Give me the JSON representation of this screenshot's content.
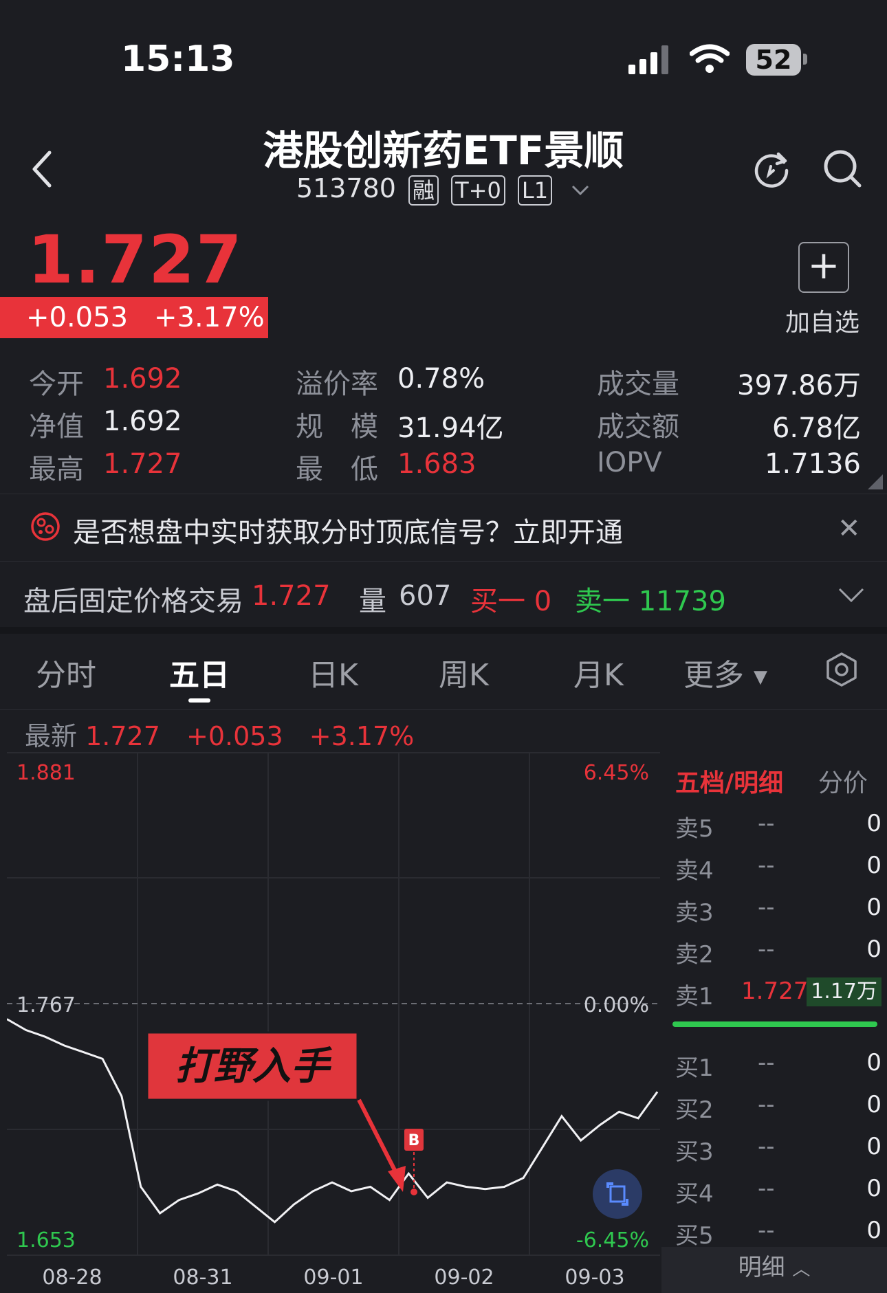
{
  "status": {
    "time": "15:13",
    "battery": "52"
  },
  "header": {
    "title": "港股创新药ETF景顺",
    "code": "513780",
    "tags": [
      "融",
      "T+0",
      "L1"
    ]
  },
  "quote": {
    "price": "1.727",
    "change": "+0.053",
    "change_pct": "+3.17%",
    "add_watchlist": "加自选"
  },
  "stats": {
    "open_label": "今开",
    "open": "1.692",
    "nav_label": "净值",
    "nav": "1.692",
    "high_label": "最高",
    "high": "1.727",
    "premium_label": "溢价率",
    "premium": "0.78%",
    "scale_label": "规　模",
    "scale": "31.94亿",
    "low_label": "最　低",
    "low": "1.683",
    "volume_label": "成交量",
    "volume": "397.86万",
    "amount_label": "成交额",
    "amount": "6.78亿",
    "iopv_label": "IOPV",
    "iopv": "1.7136"
  },
  "banner": {
    "text": "是否想盘中实时获取分时顶底信号？立即开通"
  },
  "after_hours": {
    "label": "盘后固定价格交易",
    "price": "1.727",
    "vol_label": "量",
    "vol": "607",
    "buy1": "买一 0",
    "sell1": "卖一 11739"
  },
  "tabs": [
    "分时",
    "五日",
    "日K",
    "周K",
    "月K",
    "更多"
  ],
  "latest": {
    "label": "最新",
    "price": "1.727",
    "change": "+0.053",
    "pct": "+3.17%"
  },
  "chart_data": {
    "type": "line",
    "x": [
      "08-28",
      "08-31",
      "09-01",
      "09-02",
      "09-03"
    ],
    "y_axis_left": [
      "1.881",
      "1.767",
      "1.653"
    ],
    "y_axis_right": [
      "6.45%",
      "0.00%",
      "-6.45%"
    ],
    "ylim": [
      1.653,
      1.881
    ],
    "prev_close": 1.767,
    "series": [
      {
        "values": [
          1.76,
          1.755,
          1.752,
          1.748,
          1.745,
          1.742,
          1.725,
          1.684,
          1.672,
          1.678,
          1.681,
          1.685,
          1.682,
          1.675,
          1.668,
          1.676,
          1.682,
          1.686,
          1.682,
          1.684,
          1.678,
          1.69,
          1.679,
          1.686,
          1.684,
          1.683,
          1.684,
          1.688,
          1.702,
          1.716,
          1.705,
          1.712,
          1.718,
          1.715,
          1.727
        ]
      }
    ],
    "annotation": "打野入手",
    "marker": "B"
  },
  "orderbook": {
    "title": "五档/明细",
    "tab2": "分价",
    "asks": [
      {
        "label": "卖5",
        "price": "--",
        "vol": "0"
      },
      {
        "label": "卖4",
        "price": "--",
        "vol": "0"
      },
      {
        "label": "卖3",
        "price": "--",
        "vol": "0"
      },
      {
        "label": "卖2",
        "price": "--",
        "vol": "0"
      },
      {
        "label": "卖1",
        "price": "1.727",
        "vol": "1.17万"
      }
    ],
    "bids": [
      {
        "label": "买1",
        "price": "--",
        "vol": "0"
      },
      {
        "label": "买2",
        "price": "--",
        "vol": "0"
      },
      {
        "label": "买3",
        "price": "--",
        "vol": "0"
      },
      {
        "label": "买4",
        "price": "--",
        "vol": "0"
      },
      {
        "label": "买5",
        "price": "--",
        "vol": "0"
      }
    ],
    "detail_label": "明细"
  }
}
